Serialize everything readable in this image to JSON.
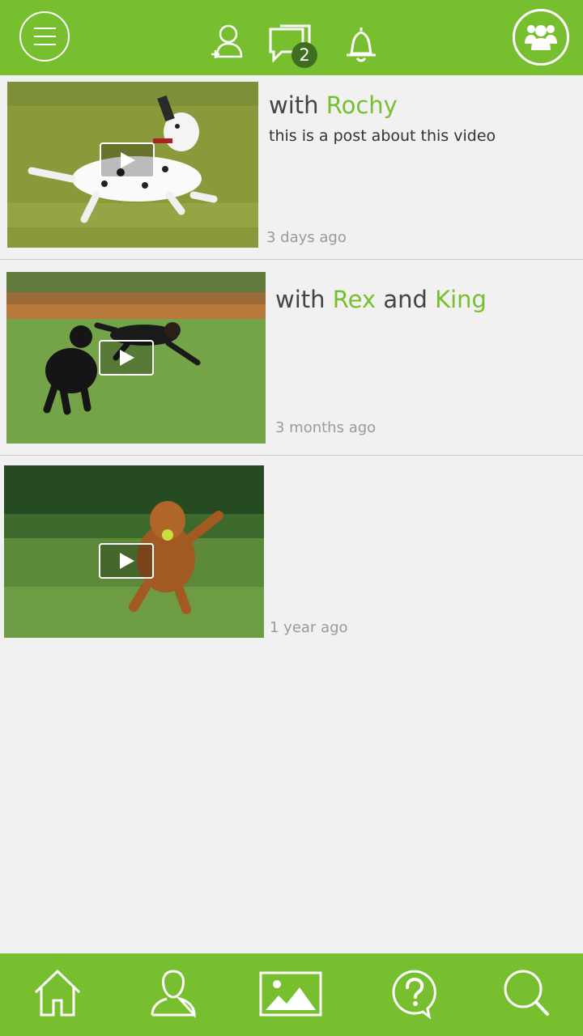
{
  "header": {
    "notification_count": "2"
  },
  "feed": [
    {
      "with_label": "with",
      "friends": [
        "Rochy"
      ],
      "description": "this is  a post about this video",
      "time": "3 days ago"
    },
    {
      "with_label": "with",
      "friends": [
        "Rex",
        "King"
      ],
      "joiner": "and",
      "description": "",
      "time": "3 months ago"
    },
    {
      "with_label": "",
      "friends": [],
      "description": "",
      "time": "1 year ago"
    }
  ],
  "colors": {
    "brand_green": "#78bf2f",
    "badge_dark": "#3f6e20"
  },
  "icons": {
    "header": [
      "menu-icon",
      "add-friend-icon",
      "messages-icon",
      "bell-icon",
      "groups-icon"
    ],
    "bottom_nav": [
      "home-icon",
      "profile-icon",
      "gallery-icon",
      "help-icon",
      "search-icon"
    ]
  }
}
